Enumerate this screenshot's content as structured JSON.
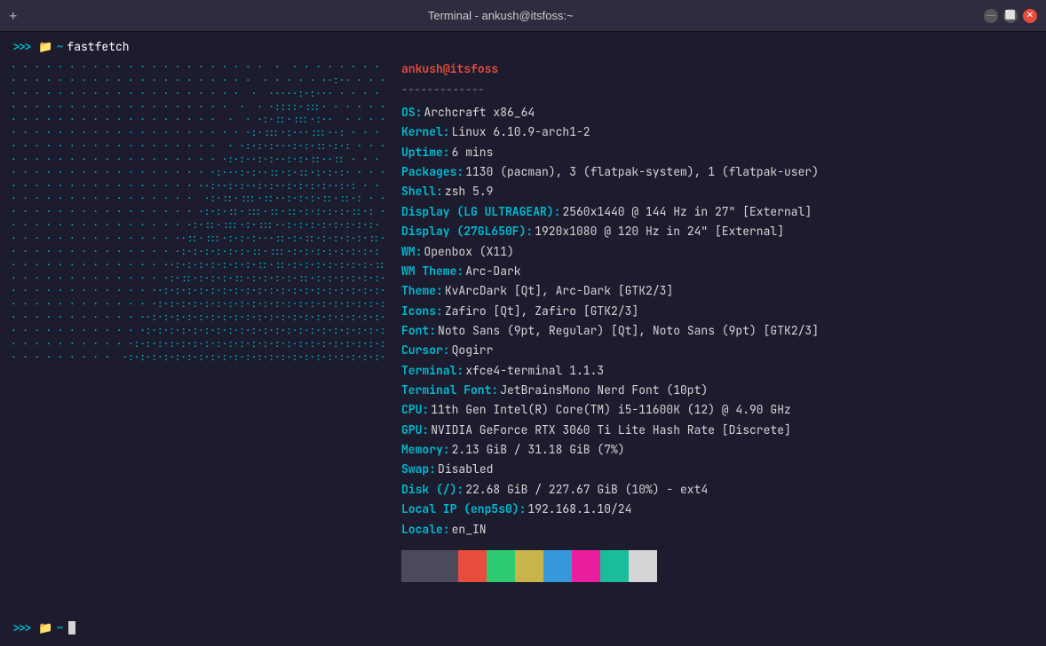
{
  "titlebar": {
    "title": "Terminal - ankush@itsfoss:~",
    "add_icon": "+",
    "min_label": "—",
    "max_label": "⬜",
    "close_label": "✕"
  },
  "top_prompt": {
    "arrow": ">>>",
    "folder": "📁",
    "tilde": "~",
    "command": "fastfetch"
  },
  "sysinfo": {
    "username": "ankush",
    "at": "@",
    "hostname": "itsfoss",
    "separator": "-------------",
    "rows": [
      {
        "label": "OS:",
        "value": " Archcraft x86_64"
      },
      {
        "label": "Kernel:",
        "value": " Linux 6.10.9-arch1-2"
      },
      {
        "label": "Uptime:",
        "value": " 6 mins"
      },
      {
        "label": "Packages:",
        "value": " 1130 (pacman), 3 (flatpak-system), 1 (flatpak-user)"
      },
      {
        "label": "Shell:",
        "value": " zsh 5.9"
      },
      {
        "label": "Display (LG ULTRAGEAR):",
        "value": " 2560x1440 @ 144 Hz in 27\" [External]"
      },
      {
        "label": "Display (27GL650F):",
        "value": " 1920x1080 @ 120 Hz in 24\" [External]"
      },
      {
        "label": "WM:",
        "value": " Openbox (X11)"
      },
      {
        "label": "WM Theme:",
        "value": " Arc-Dark"
      },
      {
        "label": "Theme:",
        "value": " KvArcDark [Qt], Arc-Dark [GTK2/3]"
      },
      {
        "label": "Icons:",
        "value": " Zafiro [Qt], Zafiro [GTK2/3]"
      },
      {
        "label": "Font:",
        "value": " Noto Sans (9pt, Regular) [Qt], Noto Sans (9pt) [GTK2/3]"
      },
      {
        "label": "Cursor:",
        "value": " Qogirr"
      },
      {
        "label": "Terminal:",
        "value": " xfce4-terminal 1.1.3"
      },
      {
        "label": "Terminal Font:",
        "value": " JetBrainsMono Nerd Font (10pt)"
      },
      {
        "label": "CPU:",
        "value": " 11th Gen Intel(R) Core(TM) i5-11600K (12) @ 4.90 GHz"
      },
      {
        "label": "GPU:",
        "value": " NVIDIA GeForce RTX 3060 Ti Lite Hash Rate [Discrete]"
      },
      {
        "label": "Memory:",
        "value": " 2.13 GiB / 31.18 GiB (7%)"
      },
      {
        "label": "Swap:",
        "value": " Disabled"
      },
      {
        "label": "Disk (/):",
        "value": " 22.68 GiB / 227.67 GiB (10%) - ext4"
      },
      {
        "label": "Local IP (enp5s0):",
        "value": " 192.168.1.10/24"
      },
      {
        "label": "Locale:",
        "value": " en_IN"
      }
    ]
  },
  "swatches": [
    "#4a4a5a",
    "#4a4a5a",
    "#e74c3c",
    "#2ecc71",
    "#c8b44a",
    "#3498db",
    "#e91e9e",
    "#1abc9c",
    "#d4d4d4"
  ],
  "bottom_prompt": {
    "arrow": ">>>",
    "tilde": "~"
  }
}
